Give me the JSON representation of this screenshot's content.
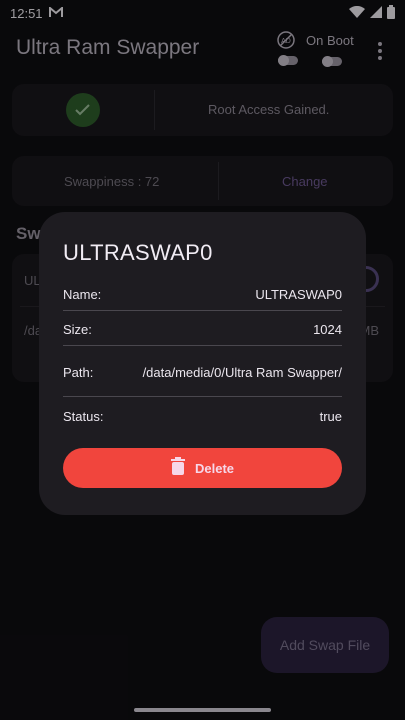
{
  "status_bar": {
    "time": "12:51"
  },
  "app_bar": {
    "title": "Ultra Ram Swapper",
    "on_boot_label": "On Boot"
  },
  "root_card": {
    "text": "Root Access Gained."
  },
  "swappiness_card": {
    "label": "Swappiness : 72",
    "change_label": "Change"
  },
  "section_title": "Sw",
  "list": {
    "item1_label": "UL",
    "item2_label": "/da",
    "item2_size": "MB"
  },
  "dialog": {
    "title": "ULTRASWAP0",
    "rows": [
      {
        "key": "Name:",
        "value": "ULTRASWAP0"
      },
      {
        "key": "Size:",
        "value": "1024"
      },
      {
        "key": "Path:",
        "value": "/data/media/0/Ultra Ram Swapper/"
      },
      {
        "key": "Status:",
        "value": "true"
      }
    ],
    "delete_label": "Delete"
  },
  "fab": {
    "label": "Add Swap File"
  },
  "colors": {
    "accent_delete": "#f1453d",
    "success_green": "#2e5e2b"
  }
}
